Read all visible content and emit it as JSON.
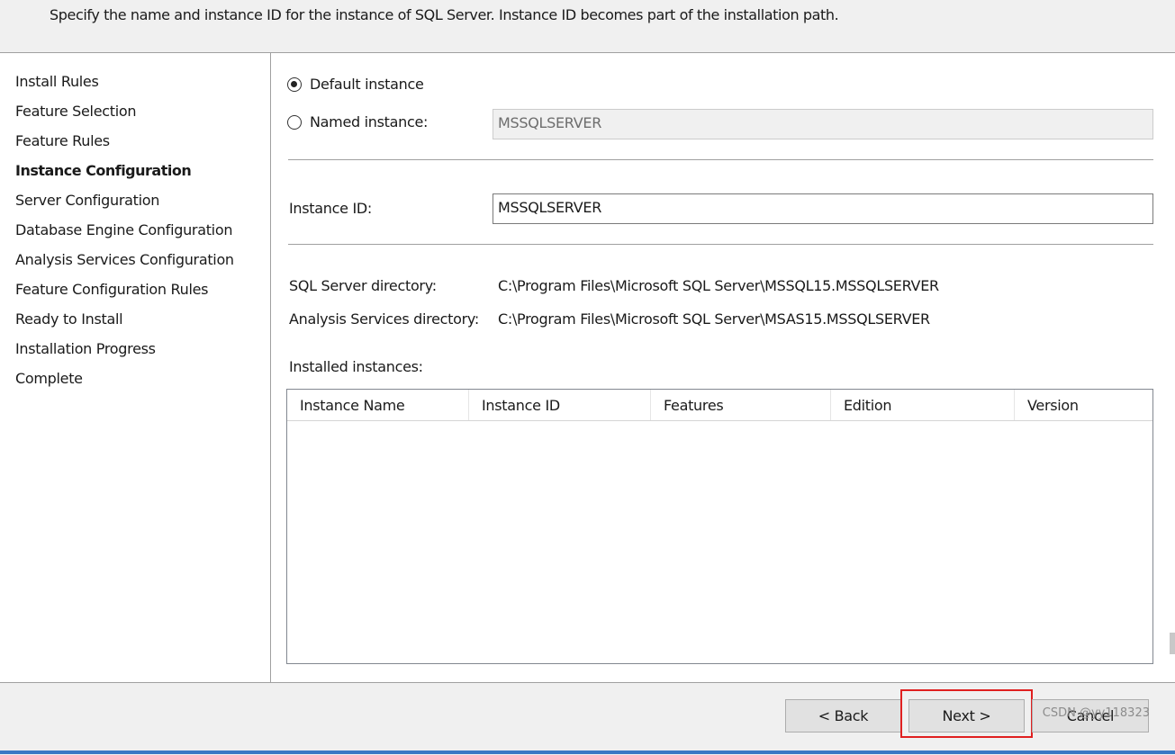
{
  "header": {
    "description": "Specify the name and instance ID for the instance of SQL Server. Instance ID becomes part of the installation path."
  },
  "sidebar": {
    "items": [
      {
        "label": "Install Rules",
        "active": false
      },
      {
        "label": "Feature Selection",
        "active": false
      },
      {
        "label": "Feature Rules",
        "active": false
      },
      {
        "label": "Instance Configuration",
        "active": true
      },
      {
        "label": "Server Configuration",
        "active": false
      },
      {
        "label": "Database Engine Configuration",
        "active": false
      },
      {
        "label": "Analysis Services Configuration",
        "active": false
      },
      {
        "label": "Feature Configuration Rules",
        "active": false
      },
      {
        "label": "Ready to Install",
        "active": false
      },
      {
        "label": "Installation Progress",
        "active": false
      },
      {
        "label": "Complete",
        "active": false
      }
    ]
  },
  "instance": {
    "default_label": "Default instance",
    "default_selected": true,
    "named_label": "Named instance:",
    "named_value": "MSSQLSERVER",
    "id_label": "Instance ID:",
    "id_value": "MSSQLSERVER"
  },
  "directories": {
    "sql_label": "SQL Server directory:",
    "sql_value": "C:\\Program Files\\Microsoft SQL Server\\MSSQL15.MSSQLSERVER",
    "as_label": "Analysis Services directory:",
    "as_value": "C:\\Program Files\\Microsoft SQL Server\\MSAS15.MSSQLSERVER"
  },
  "installed": {
    "label": "Installed instances:",
    "columns": [
      "Instance Name",
      "Instance ID",
      "Features",
      "Edition",
      "Version"
    ],
    "rows": []
  },
  "footer": {
    "back_label": "< Back",
    "next_label": "Next >",
    "cancel_label": "Cancel"
  },
  "watermark": "CSDN @yy118323",
  "colors": {
    "highlight": "#e02020",
    "taskbar": "#3a78c4"
  }
}
